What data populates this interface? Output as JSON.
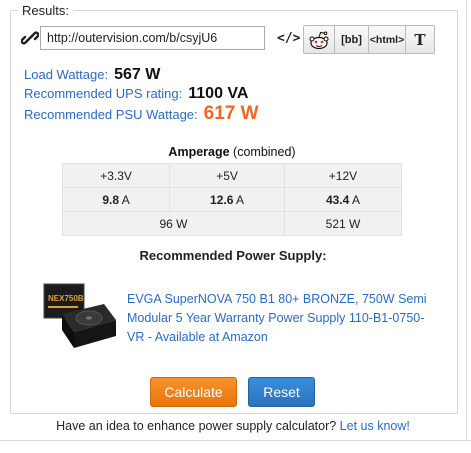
{
  "results": {
    "legend": "Results:",
    "url_value": "http://outervision.com/b/csyjU6",
    "share": {
      "code_label": "</>",
      "bb_label": "[bb]",
      "html_label": "<html>",
      "text_label": "T"
    }
  },
  "summary": {
    "load_label": "Load Wattage:",
    "load_value": "567 W",
    "ups_label": "Recommended UPS rating:",
    "ups_value": "1100 VA",
    "psu_label": "Recommended PSU Wattage:",
    "psu_value": "617 W"
  },
  "amperage": {
    "title": "Amperage",
    "subtitle": "(combined)",
    "rails": [
      "+3.3V",
      "+5V",
      "+12V"
    ],
    "amps": [
      {
        "value": "9.8",
        "unit": "A"
      },
      {
        "value": "12.6",
        "unit": "A"
      },
      {
        "value": "43.4",
        "unit": "A"
      }
    ],
    "watts_combined": "96 W",
    "watts_12v": "521 W"
  },
  "recommended": {
    "title": "Recommended Power Supply:",
    "product_link": "EVGA SuperNOVA 750 B1 80+ BRONZE, 750W Semi Modular 5 Year Warranty Power Supply 110-B1-0750-VR - Available at Amazon",
    "box_text": "NEX750B"
  },
  "buttons": {
    "calculate": "Calculate",
    "reset": "Reset"
  },
  "footer": {
    "text": "Have an idea to enhance power supply calculator?",
    "link": "Let us know!"
  },
  "colors": {
    "link_blue": "#2a6bbf",
    "psu_orange": "#f26522",
    "calc_orange": "#f28a1e",
    "reset_blue": "#3380cc"
  }
}
